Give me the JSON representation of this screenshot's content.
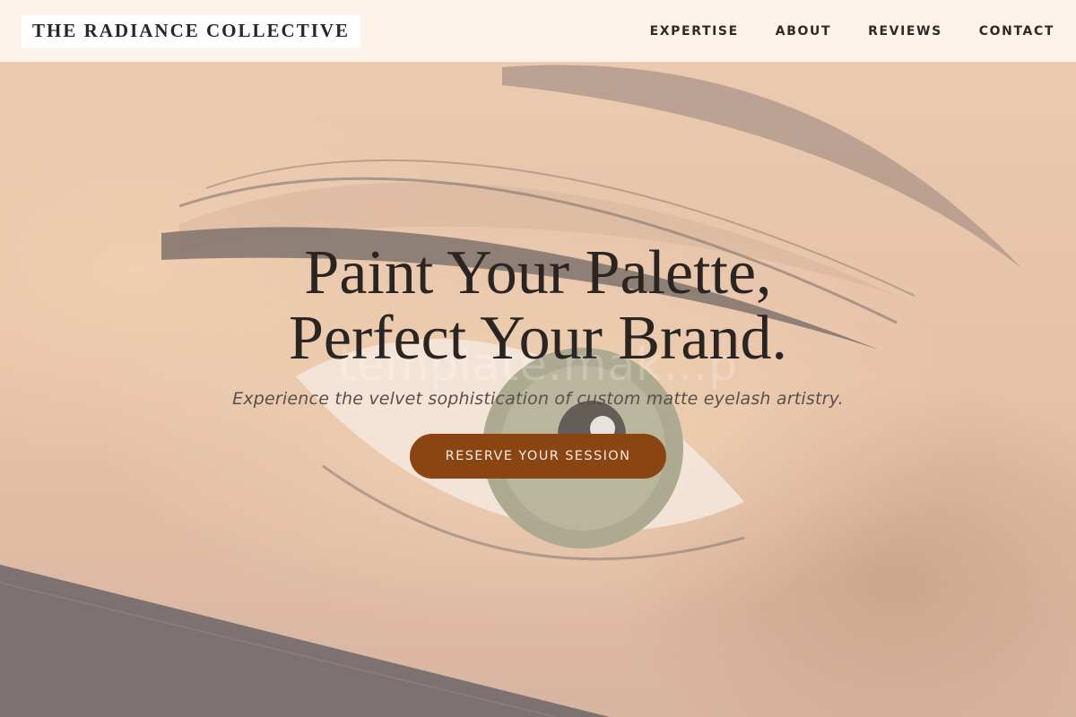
{
  "brand": {
    "name": "THE RADIANCE COLLECTIVE"
  },
  "nav": {
    "items": [
      {
        "label": "EXPERTISE"
      },
      {
        "label": "ABOUT"
      },
      {
        "label": "REVIEWS"
      },
      {
        "label": "CONTACT"
      }
    ]
  },
  "hero": {
    "headline_line1": "Paint Your Palette,",
    "headline_line2": "Perfect Your Brand.",
    "subtitle": "Experience the velvet sophistication of custom matte eyelash artistry.",
    "cta_label": "RESERVE YOUR SESSION",
    "image": "eye-with-eyelash-extensions-photo",
    "watermark": "template.mak…p"
  },
  "colors": {
    "accent": "#8b4513",
    "header_bg": "#fff8f3",
    "text_dark": "#2a2422"
  }
}
